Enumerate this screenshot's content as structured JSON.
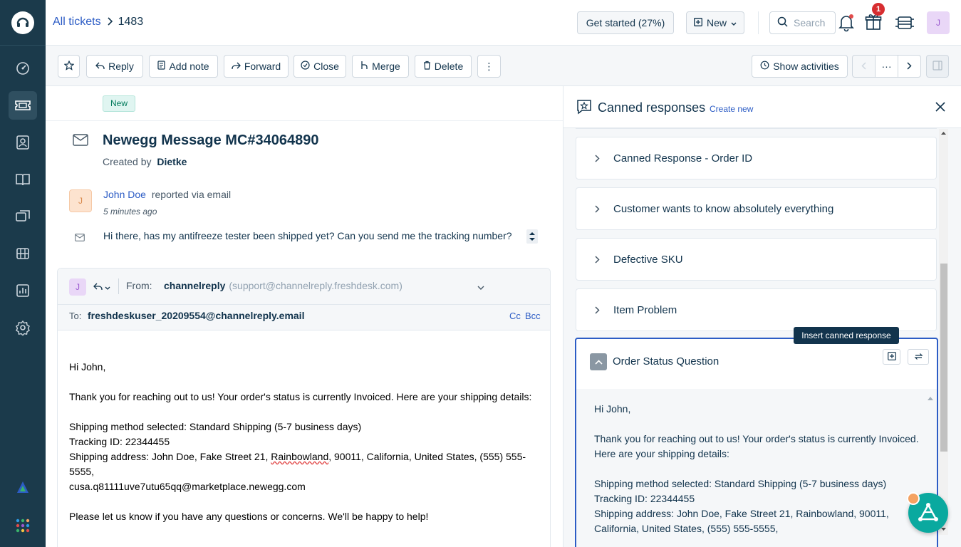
{
  "sidebar": {
    "items": [
      "dashboard-icon",
      "tickets-icon",
      "contacts-icon",
      "knowledge-base-icon",
      "forums-icon",
      "assets-icon",
      "reports-icon",
      "settings-icon"
    ]
  },
  "topbar": {
    "breadcrumb_link": "All tickets",
    "ticket_number": "1483",
    "get_started": "Get started (27%)",
    "new_label": "New",
    "search_placeholder": "Search",
    "gift_badge": "1",
    "avatar_initial": "J"
  },
  "toolbar": {
    "reply": "Reply",
    "add_note": "Add note",
    "forward": "Forward",
    "close": "Close",
    "merge": "Merge",
    "delete": "Delete",
    "more": "⋮",
    "show_activities": "Show activities",
    "ellipsis": "···"
  },
  "ticket": {
    "status": "New",
    "subject": "Newegg Message MC#34064890",
    "created_by_label": "Created by",
    "created_by": "Dietke",
    "requester": "John Doe",
    "reported_via": "reported via email",
    "time_ago": "5 minutes ago",
    "avatar_initial": "J",
    "message": "Hi there, has my antifreeze tester been shipped yet? Can you send me the tracking number?"
  },
  "reply": {
    "avatar_initial": "J",
    "from_label": "From:",
    "from_name": "channelreply",
    "from_email": "(support@channelreply.freshdesk.com)",
    "to_label": "To:",
    "to_email": "freshdeskuser_20209554@channelreply.email",
    "cc": "Cc",
    "bcc": "Bcc",
    "greeting": "Hi John,",
    "line1": "Thank you for reaching out to us! Your order's status is currently Invoiced. Here are your shipping details:",
    "shipping_method": "Shipping method selected: Standard Shipping (5-7 business days)",
    "tracking": "Tracking ID: 22344455",
    "address_prefix": "Shipping address: John Doe, Fake Street 21, ",
    "address_city": "Rainbowland",
    "address_suffix": ", 90011, California, United States, (555) 555-5555,",
    "address_email": "cusa.q81111uve7utu65qq@marketplace.newegg.com",
    "closing": "Please let us know if you have any questions or concerns. We'll be happy to help!"
  },
  "canned": {
    "title": "Canned responses",
    "create_new": "Create new",
    "items": [
      "Canned Response - Order ID",
      "Customer wants to know absolutely everything",
      "Defective SKU",
      "Item Problem"
    ],
    "open_title": "Order Status Question",
    "tooltip": "Insert canned response",
    "preview": {
      "greeting": "Hi John,",
      "line1": "Thank you for reaching out to us! Your order's status is currently Invoiced. Here are your shipping details:",
      "shipping_method": "Shipping method selected: Standard Shipping (5-7 business days)",
      "tracking": "Tracking ID: 22344455",
      "address": "Shipping address: John Doe, Fake Street 21, Rainbowland, 90011, California, United States, (555) 555-5555,"
    }
  },
  "colors": {
    "sidebar": "#1b3a4b",
    "link": "#2c5cc5",
    "accent": "#2c5cc5",
    "badge_red": "#d72d30",
    "fab": "#0aa99f"
  }
}
